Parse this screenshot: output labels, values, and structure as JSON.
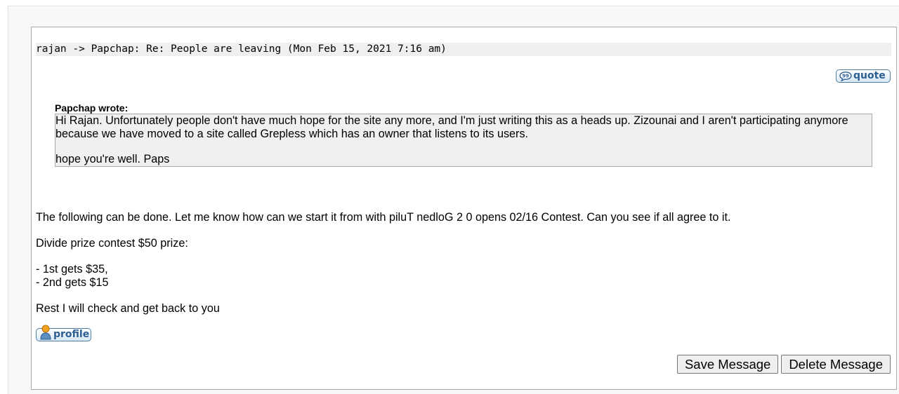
{
  "message": {
    "header": "rajan -> Papchap: Re: People are leaving (Mon Feb 15, 2021 7:16 am)",
    "quote_button": "quote",
    "quoted": {
      "author": "Papchap wrote:",
      "line1": "Hi Rajan. Unfortunately people don't have much hope for the site any more, and I'm just writing this as a heads up. Zizounai and I aren't participating anymore",
      "line2": "because we have moved to a site called Grepless which has an owner that listens to its users.",
      "line3": "hope you're well. Paps"
    },
    "body": {
      "p1": "The following can be done. Let me know how can we start it from with piluT nedloG 2 0 opens 02/16 Contest. Can you see if all agree to it.",
      "p2": "Divide prize contest $50 prize:",
      "p3_line1": "- 1st gets $35,",
      "p3_line2": "- 2nd gets $15",
      "p4": "Rest I will check and get back to you"
    },
    "profile_button": "profile",
    "save_button": "Save Message",
    "delete_button": "Delete Message"
  },
  "colors": {
    "page_bg": "#f8f8f8",
    "panel_border": "#a9a9a9",
    "header_bg": "#efefef",
    "quote_bg": "#f0f0f0",
    "image_button_text": "#2b5e92"
  },
  "icons": [
    "speech-bubble-icon",
    "user-icon"
  ]
}
